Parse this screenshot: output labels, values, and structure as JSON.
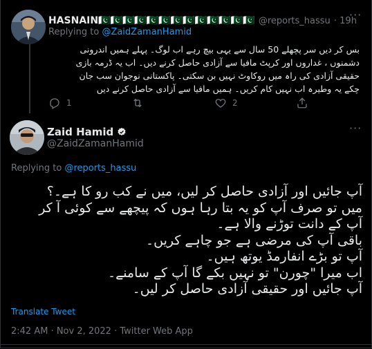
{
  "reply": {
    "name": "HASNAIN🇵🇰🇵🇰🇵🇰🇵🇰🇵🇰🇵🇰🇵🇰🇵🇰🇵🇰🇵🇰🇵🇰🇵🇰🇵🇰",
    "handle": "@reports_hassu",
    "time": "· 19h",
    "replying_prefix": "Replying to",
    "replying_to": "@ZaidZamanHamid",
    "text_lines": [
      "بس کر دیں سر پچھلے 50 سال سے یہی بیچ رہے اب لوگ۔ پہلے ہمیں اندرونی",
      "دشمنوں ، غداروں اور کرپٹ مافیا سے آزادی حاصل کرنے دیں۔ اب یہ ڈرمہ بازی",
      "حقیقی آزادی کی راہ میں روکاوٹ نہیں بن سکتی۔ پاکستانی نوجوان سب جان",
      "چکے یہ وطیرہ اب نہیں کام کریں۔ ہمیں مافیا سے آزادی حاصل کرنے دیں"
    ],
    "actions": {
      "reply_count": "1",
      "retweet_count": "",
      "like_count": "2"
    },
    "icons": [
      "reply-icon",
      "retweet-icon",
      "like-icon",
      "share-icon",
      "more-icon"
    ]
  },
  "main": {
    "name": "Zaid Hamid",
    "handle": "@ZaidZamanHamid",
    "verified_color": "#e7e9ea",
    "replying_prefix": "Replying to",
    "replying_to": "@reports_hassu",
    "text_lines": [
      "آپ جائیں اور آزادی حاصل کر لیں، میں نے کب رو کا ہے۔؟",
      "میں تو صرف آپ کو یہ بتا رہا ہوں کہ پیچھے سے کوئی آ کر",
      "آپ کے دانت توڑنے والا ہے۔",
      "باقی آپ کی مرضی ہے جو چاہے کریں۔",
      "آپ تو بڑے انفارمڈ یوتھ ہیں۔",
      "اب میرا \"چورن\" تو نہیں بکے گا آپ کے سامنے۔",
      "آپ جائیں اور حقیقی آزادی حاصل کر لیں۔"
    ],
    "translate_label": "Translate Tweet",
    "timestamp": "2:42 AM · Nov 2, 2022 · Twitter Web App"
  },
  "colors": {
    "background": "#000000",
    "text": "#e7e9ea",
    "muted": "#71767b",
    "link": "#1d9bf0",
    "divider": "#2f3336"
  }
}
